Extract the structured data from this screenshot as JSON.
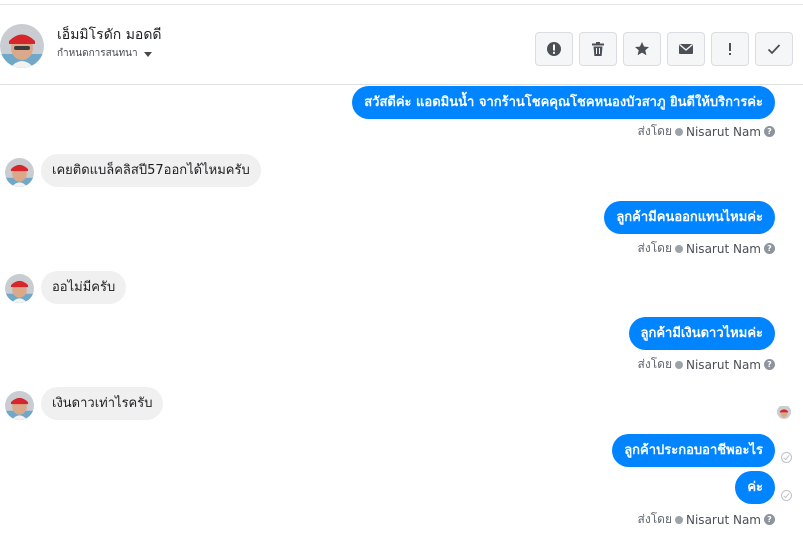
{
  "contact": {
    "name": "เอ็มมิโรดัก มอดดี",
    "assign_label": "กำหนดการสนทนา"
  },
  "toolbar": {
    "buttons": [
      {
        "name": "report-spam-button",
        "icon": "alert-circle-icon"
      },
      {
        "name": "delete-button",
        "icon": "trash-icon"
      },
      {
        "name": "star-button",
        "icon": "star-icon"
      },
      {
        "name": "mark-unread-button",
        "icon": "envelope-icon"
      },
      {
        "name": "follow-up-button",
        "icon": "exclamation-icon"
      },
      {
        "name": "mark-done-button",
        "icon": "check-icon"
      }
    ]
  },
  "messages": [
    {
      "direction": "out",
      "text": "สวัสดีค่ะ แอดมินน้ำ จากร้านโชคคุณโชคหนองบัวสาภู ยินดีให้บริการค่ะ"
    },
    {
      "direction": "in",
      "text": "เคยติดแบล็คลิสปี57ออกได้ไหมครับ"
    },
    {
      "direction": "out",
      "text": "ลูกค้ามีคนออกแทนไหมค่ะ"
    },
    {
      "direction": "in",
      "text": "ออไม่มีครับ"
    },
    {
      "direction": "out",
      "text": "ลูกค้ามีเงินดาวไหมค่ะ"
    },
    {
      "direction": "in",
      "text": "เงินดาวเท่าไรครับ"
    },
    {
      "direction": "out",
      "text": "ลูกค้าประกอบอาชีพอะไร"
    },
    {
      "direction": "out",
      "text": "ค่ะ"
    }
  ],
  "sent_by": {
    "prefix": "ส่งโดย",
    "agent": "Nisarut Nam"
  },
  "colors": {
    "outgoing_bubble": "#0084ff",
    "incoming_bubble": "#f0f0f0",
    "toolbar_button_bg": "#f5f6f7"
  }
}
